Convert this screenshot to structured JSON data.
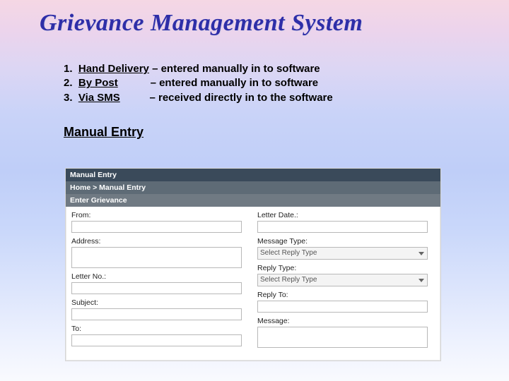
{
  "title": "Grievance Management System",
  "methods": {
    "items": [
      {
        "num": "1.",
        "name": "Hand Delivery",
        "pad": " ",
        "desc": "– entered manually in to software"
      },
      {
        "num": "2.",
        "name": "By Post",
        "pad": "           ",
        "desc": "– entered manually in to software"
      },
      {
        "num": "3.",
        "name": "Via SMS",
        "pad": "          ",
        "desc": "– received directly in to the software"
      }
    ]
  },
  "section_heading": "Manual Entry",
  "form": {
    "bar1": "Manual Entry",
    "bar2": "Home > Manual Entry",
    "bar3": "Enter Grievance",
    "left": {
      "from": "From:",
      "address": "Address:",
      "letter_no": "Letter No.:",
      "subject": "Subject:",
      "to": "To:"
    },
    "right": {
      "letter_date": "Letter Date.:",
      "message_type": "Message Type:",
      "message_type_value": "Select Reply Type",
      "reply_type": "Reply Type:",
      "reply_type_value": "Select Reply Type",
      "reply_to": "Reply To:",
      "message": "Message:"
    }
  }
}
